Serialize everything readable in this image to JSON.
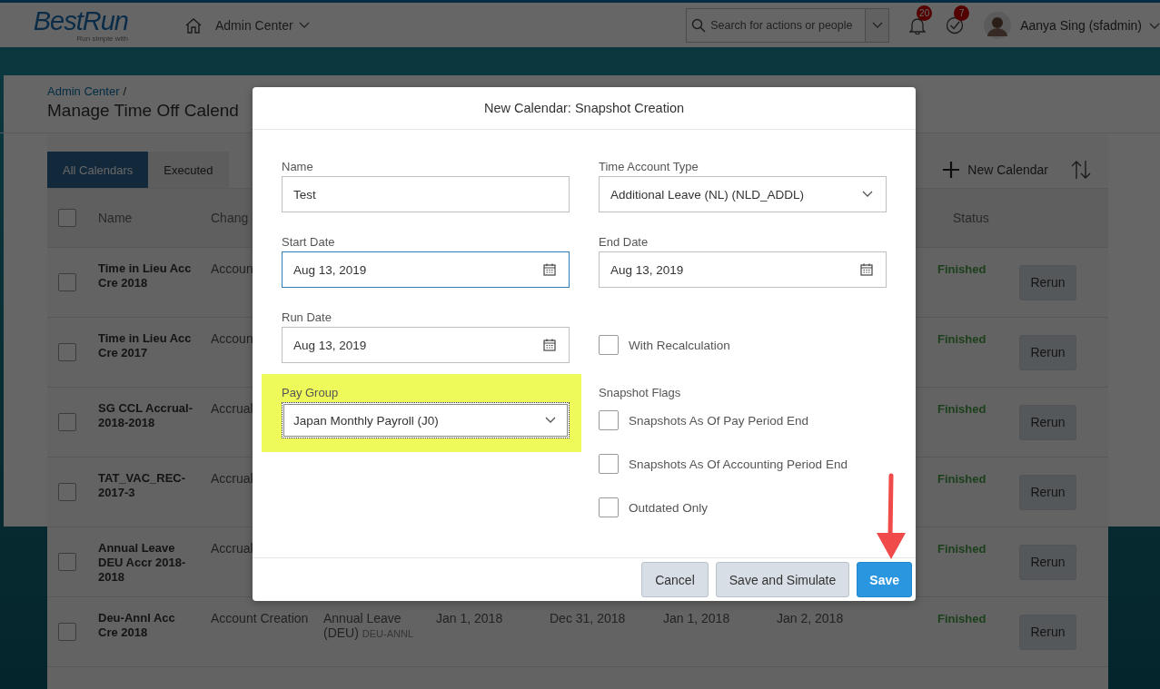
{
  "header": {
    "logo": "BestRun",
    "logo_tagline": "Run simple with",
    "nav": "Admin Center",
    "search": {
      "placeholder": "Search for actions or people"
    },
    "notifications": "20",
    "tasks": "7",
    "user": "Aanya Sing (sfadmin)"
  },
  "page": {
    "breadcrumb": "Admin Center",
    "breadcrumb_separator": "/",
    "title": "Manage Time Off Calend",
    "tabs": [
      {
        "label": "All Calendars",
        "selected": true
      },
      {
        "label": "Executed",
        "selected": false
      }
    ],
    "new_button": "New Calendar"
  },
  "table": {
    "select_all_checked": false,
    "columns": {
      "name": "Name",
      "change": "Chang",
      "status": "Status"
    },
    "rows": [
      {
        "checked": false,
        "name": "Time in Lieu Acc Cre 2018",
        "change": "Accoun",
        "status": "Finished",
        "action": "Rerun"
      },
      {
        "checked": false,
        "name": "Time in Lieu Acc Cre 2017",
        "change": "Accoun",
        "status": "Finished",
        "action": "Rerun"
      },
      {
        "checked": false,
        "name": "SG CCL Accrual-2018-2018",
        "change": "Accrual",
        "status": "Finished",
        "action": "Rerun"
      },
      {
        "checked": false,
        "name": "TAT_VAC_REC-2017-3",
        "change": "Accrual",
        "status": "Finished",
        "action": "Rerun"
      },
      {
        "checked": false,
        "name": "Annual Leave DEU Accr 2018-2018",
        "change": "Accrual",
        "status": "Finished",
        "action": "Rerun"
      },
      {
        "checked": false,
        "name": "Deu-Annl Acc Cre 2018",
        "change": "Account Creation",
        "account": "Annual Leave (DEU)",
        "account_code": "DEU-ANNL",
        "dates": [
          "Jan 1, 2018",
          "Dec 31, 2018",
          "Jan 1, 2018",
          "Jan 2, 2018"
        ],
        "status": "Finished",
        "action": "Rerun"
      }
    ]
  },
  "dialog": {
    "title": "New Calendar: Snapshot Creation",
    "fields": [
      {
        "kind": "text",
        "label": "Name",
        "value": "Test",
        "focused": false,
        "highlighted": false
      },
      {
        "kind": "select",
        "label": "Time Account Type",
        "value": "Additional Leave (NL) (NLD_ADDL)",
        "focused": false,
        "highlighted": false
      },
      {
        "kind": "date",
        "label": "Start Date",
        "value": "Aug 13, 2019",
        "focused": true,
        "highlighted": false
      },
      {
        "kind": "date",
        "label": "End Date",
        "value": "Aug 13, 2019",
        "focused": false,
        "highlighted": false
      },
      {
        "kind": "date",
        "label": "Run Date",
        "value": "Aug 13, 2019",
        "focused": false,
        "highlighted": false
      },
      {
        "kind": "checkbox",
        "label": "With Recalculation",
        "checked": false
      },
      {
        "kind": "select",
        "label": "Pay Group",
        "value": "Japan Monthly Payroll (J0)",
        "focused": true,
        "highlighted": true
      },
      {
        "kind": "group",
        "label": "Snapshot Flags",
        "options": [
          {
            "label": "Snapshots As Of Pay Period End",
            "checked": false
          },
          {
            "label": "Snapshots As Of Accounting Period End",
            "checked": false
          },
          {
            "label": "Outdated Only",
            "checked": false
          }
        ]
      }
    ],
    "buttons": [
      {
        "label": "Cancel",
        "kind": "secondary"
      },
      {
        "label": "Save and Simulate",
        "kind": "secondary"
      },
      {
        "label": "Save",
        "kind": "primary"
      }
    ]
  }
}
